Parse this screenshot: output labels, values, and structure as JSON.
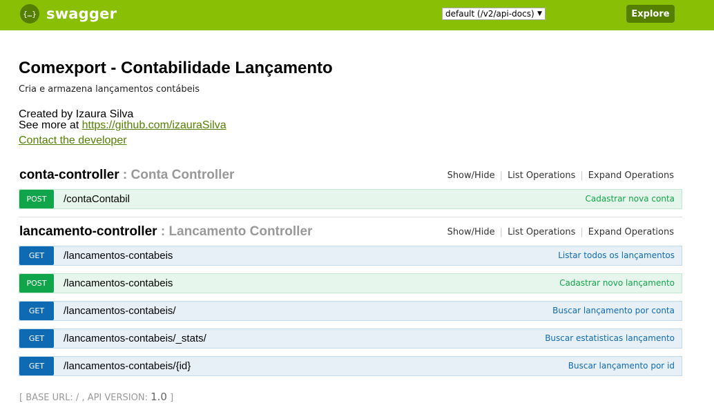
{
  "header": {
    "brand": "swagger",
    "spec_select": "default (/v2/api-docs)",
    "explore_label": "Explore"
  },
  "info": {
    "title": "Comexport - Contabilidade Lançamento",
    "description": "Cria e armazena lançamentos contábeis",
    "created_by": "Created by Izaura Silva",
    "see_more_prefix": "See more at ",
    "see_more_link": "https://github.com/izauraSilva",
    "contact_label": "Contact the developer"
  },
  "resources": [
    {
      "name": "conta-controller",
      "separator": " : ",
      "description": "Conta Controller",
      "links": {
        "show_hide": "Show/Hide",
        "list_ops": "List Operations",
        "expand_ops": "Expand Operations"
      },
      "operations": [
        {
          "method": "POST",
          "path": "/contaContabil",
          "summary": "Cadastrar nova conta"
        }
      ]
    },
    {
      "name": "lancamento-controller",
      "separator": " : ",
      "description": "Lancamento Controller",
      "links": {
        "show_hide": "Show/Hide",
        "list_ops": "List Operations",
        "expand_ops": "Expand Operations"
      },
      "operations": [
        {
          "method": "GET",
          "path": "/lancamentos-contabeis",
          "summary": "Listar todos os lançamentos"
        },
        {
          "method": "POST",
          "path": "/lancamentos-contabeis",
          "summary": "Cadastrar novo lançamento"
        },
        {
          "method": "GET",
          "path": "/lancamentos-contabeis/",
          "summary": "Buscar lançamento por conta"
        },
        {
          "method": "GET",
          "path": "/lancamentos-contabeis/_stats/",
          "summary": "Buscar estatisticas lançamento"
        },
        {
          "method": "GET",
          "path": "/lancamentos-contabeis/{id}",
          "summary": "Buscar lançamento por id"
        }
      ]
    }
  ],
  "footer": {
    "prefix": "[ BASE URL: / , API VERSION: ",
    "version": "1.0",
    "suffix": " ]"
  },
  "colors": {
    "header_bg": "#89bf04",
    "explore_bg": "#547f00",
    "post": "#10a54a",
    "get": "#0f6ab4"
  }
}
